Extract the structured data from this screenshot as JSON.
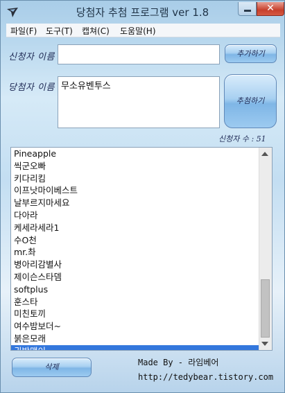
{
  "window": {
    "title": "당첨자 추첨 프로그램 ver 1.8",
    "close_glyph": "✕"
  },
  "menu": [
    {
      "label": "파일(F)"
    },
    {
      "label": "도구(T)"
    },
    {
      "label": "캡쳐(C)"
    },
    {
      "label": "도움말(H)"
    }
  ],
  "form": {
    "applicant_label": "신청자 이름",
    "applicant_value": "",
    "add_button": "추가하기",
    "winner_label": "당첨자 이름",
    "winner_value": "무소유벤투스",
    "draw_button": "추첨하기",
    "count_label": "신청자 수 : 51"
  },
  "list": {
    "items": [
      "Pineapple",
      "씩군오빠",
      "키다리킴",
      "이프낫마이베스트",
      "날부르지마세요",
      "다아라",
      "케세라세라1",
      "수O천",
      "mr.촤",
      "병아리감별사",
      "제이슨스타뎀",
      "softplus",
      "훈스타",
      "미친토끼",
      "여수밤보더~",
      "붉은모래",
      "귓방맹이"
    ],
    "selected_index": 16
  },
  "footer": {
    "delete_button": "삭제",
    "made_by": "Made By - 라임베어",
    "url": "http://tedybear.tistory.com"
  },
  "colors": {
    "selection": "#3377dd",
    "close_button": "#c7402c"
  }
}
